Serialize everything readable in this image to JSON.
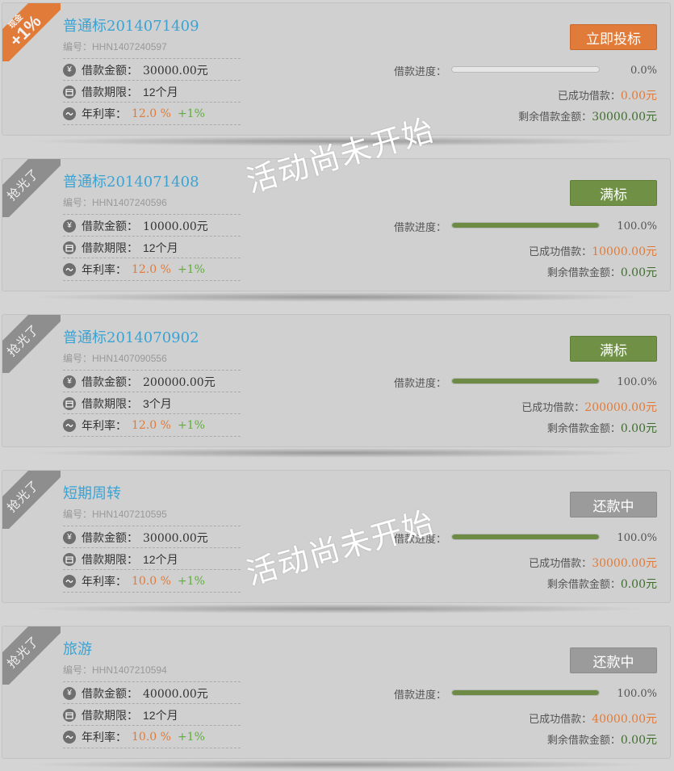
{
  "common": {
    "code_prefix": "编号：",
    "amount_label": "借款金额：",
    "term_label": "借款期限：",
    "rate_label": "年利率：",
    "progress_label": "借款进度：",
    "success_label": "已成功借款：",
    "remaining_label": "剩余借款金额：",
    "rate_unit": "%",
    "bonus": "+1%"
  },
  "watermark": "活动尚未开始",
  "loans": [
    {
      "ribbon_type": "cash",
      "ribbon_top": "现金",
      "ribbon_main": "+1%",
      "title": "普通标2014071409",
      "code": "HHN1407240597",
      "amount": "30000.00元",
      "term": "12个月",
      "rate": "12.0",
      "button": "立即投标",
      "button_style": "orange",
      "progress": 0.0,
      "progress_text": "0.0%",
      "success_amount": "0.00元",
      "remaining_amount": "30000.00元"
    },
    {
      "ribbon_type": "sold-out",
      "ribbon_text": "抢光了",
      "title": "普通标2014071408",
      "code": "HHN1407240596",
      "amount": "10000.00元",
      "term": "12个月",
      "rate": "12.0",
      "button": "满标",
      "button_style": "green",
      "progress": 1.0,
      "progress_text": "100.0%",
      "success_amount": "10000.00元",
      "remaining_amount": "0.00元"
    },
    {
      "ribbon_type": "sold-out",
      "ribbon_text": "抢光了",
      "title": "普通标2014070902",
      "code": "HHN1407090556",
      "amount": "200000.00元",
      "term": "3个月",
      "rate": "12.0",
      "button": "满标",
      "button_style": "green",
      "progress": 1.0,
      "progress_text": "100.0%",
      "success_amount": "200000.00元",
      "remaining_amount": "0.00元"
    },
    {
      "ribbon_type": "sold-out",
      "ribbon_text": "抢光了",
      "title": "短期周转",
      "code": "HHN1407210595",
      "amount": "30000.00元",
      "term": "12个月",
      "rate": "10.0",
      "button": "还款中",
      "button_style": "grey",
      "progress": 1.0,
      "progress_text": "100.0%",
      "success_amount": "30000.00元",
      "remaining_amount": "0.00元"
    },
    {
      "ribbon_type": "sold-out",
      "ribbon_text": "抢光了",
      "title": "旅游",
      "code": "HHN1407210594",
      "amount": "40000.00元",
      "term": "12个月",
      "rate": "10.0",
      "button": "还款中",
      "button_style": "grey",
      "progress": 1.0,
      "progress_text": "100.0%",
      "success_amount": "40000.00元",
      "remaining_amount": "0.00元"
    }
  ],
  "colors": {
    "accent_orange": "#e07b3a",
    "title_blue": "#3aa3d4",
    "full_green": "#709145",
    "bonus_green": "#5fae3c"
  }
}
